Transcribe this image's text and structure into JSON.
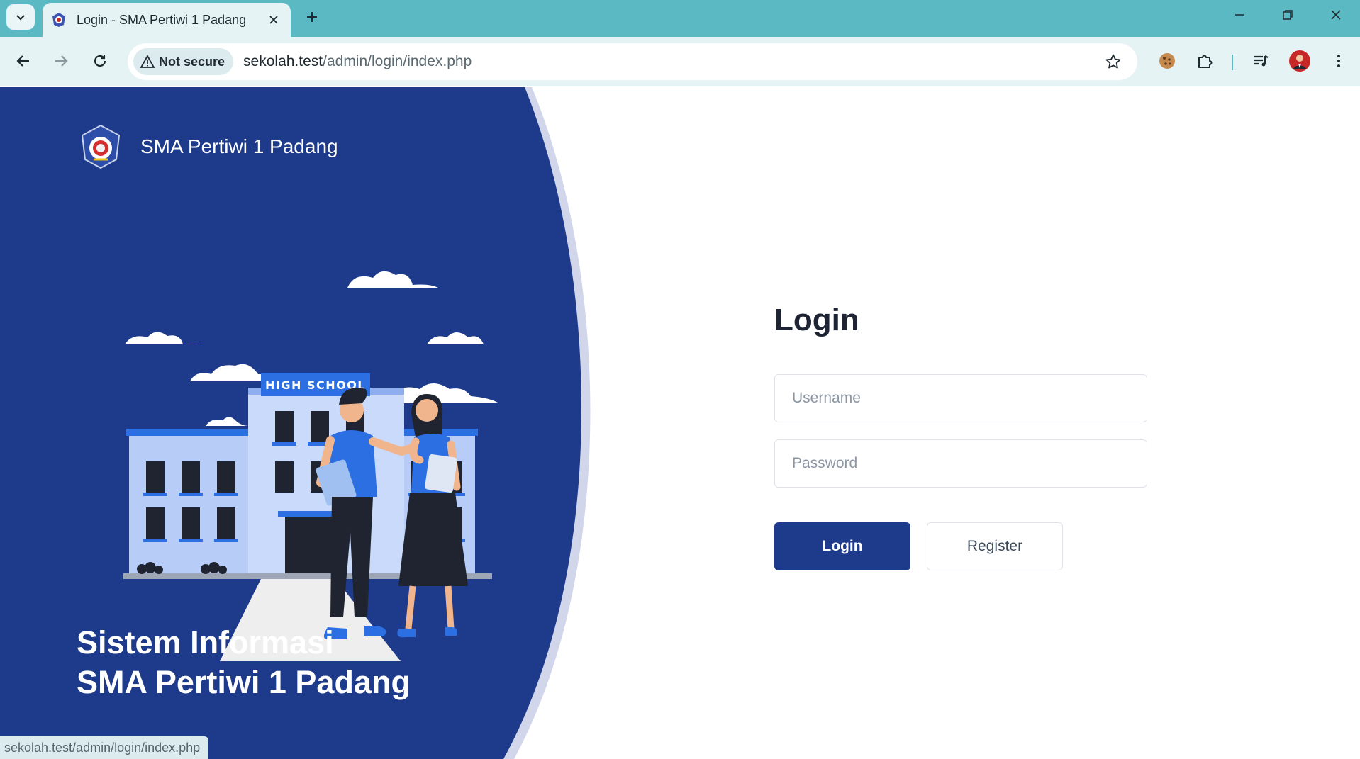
{
  "browser": {
    "tab_title": "Login - SMA Pertiwi 1 Padang",
    "security_label": "Not secure",
    "url_host": "sekolah.test",
    "url_path": "/admin/login/index.php",
    "status_url": "sekolah.test/admin/login/index.php",
    "accent_color": "#5ab9c3"
  },
  "brand": {
    "name": "SMA Pertiwi 1 Padang"
  },
  "illustration": {
    "sign_text": "HIGH SCHOOL"
  },
  "hero": {
    "line1": "Sistem Informasi",
    "line2": "SMA Pertiwi 1 Padang",
    "panel_color": "#1e3a8a"
  },
  "login": {
    "heading": "Login",
    "username_placeholder": "Username",
    "password_placeholder": "Password",
    "login_button": "Login",
    "register_button": "Register"
  }
}
